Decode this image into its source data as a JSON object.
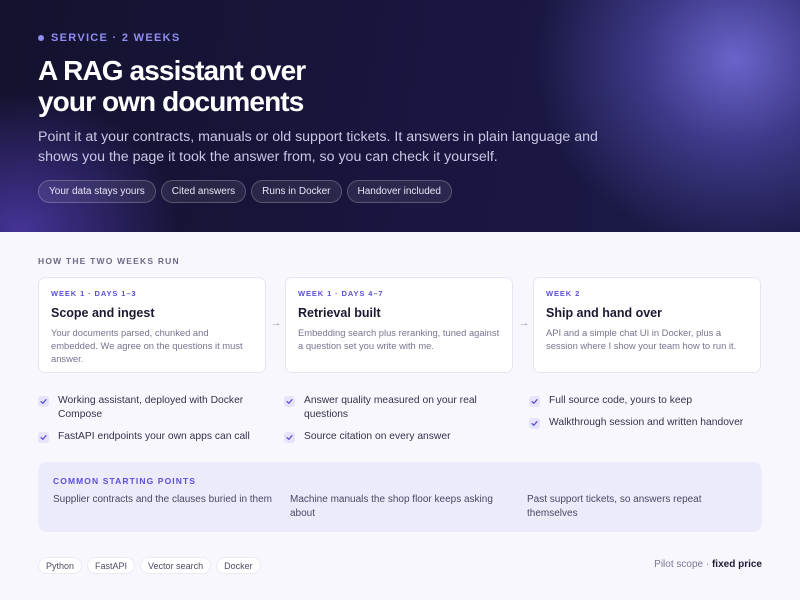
{
  "hero": {
    "eyebrow": "SERVICE · 2 WEEKS",
    "title_line1": "A RAG assistant over",
    "title_line2": "your own documents",
    "lead": "Point it at your contracts, manuals or old support tickets. It answers in plain language and shows you the page it took the answer from, so you can check it yourself.",
    "chips": [
      "Your data stays yours",
      "Cited answers",
      "Runs in Docker",
      "Handover included"
    ]
  },
  "timeline": {
    "label": "HOW THE TWO WEEKS RUN",
    "weeks": [
      {
        "tag": "WEEK 1 · DAYS 1–3",
        "title": "Scope and ingest",
        "desc": "Your documents parsed, chunked and embedded. We agree on the questions it must answer.",
        "deliverables": [
          "Working assistant, deployed with Docker Compose",
          "FastAPI endpoints your own apps can call"
        ]
      },
      {
        "tag": "WEEK 1 · DAYS 4–7",
        "title": "Retrieval built",
        "desc": "Embedding search plus reranking, tuned against a question set you write with me.",
        "deliverables": [
          "Answer quality measured on your real questions",
          "Source citation on every answer"
        ]
      },
      {
        "tag": "WEEK 2",
        "title": "Ship and hand over",
        "desc": "API and a simple chat UI in Docker, plus a session where I show your team how to run it.",
        "deliverables": [
          "Full source code, yours to keep",
          "Walkthrough session and written handover"
        ]
      }
    ],
    "arrow": "→"
  },
  "starting": {
    "label": "COMMON STARTING POINTS",
    "items": [
      "Supplier contracts and the clauses buried in them",
      "Machine manuals the shop floor keeps asking about",
      "Past support tickets, so answers repeat themselves"
    ]
  },
  "tech": [
    "Python",
    "FastAPI",
    "Vector search",
    "Docker"
  ],
  "pricing": {
    "prefix": "Pilot scope · ",
    "value": "fixed price"
  },
  "colors": {
    "accent": "#5a4fd8",
    "hero_bg": "#191640",
    "page_bg": "#f8f7fe"
  }
}
